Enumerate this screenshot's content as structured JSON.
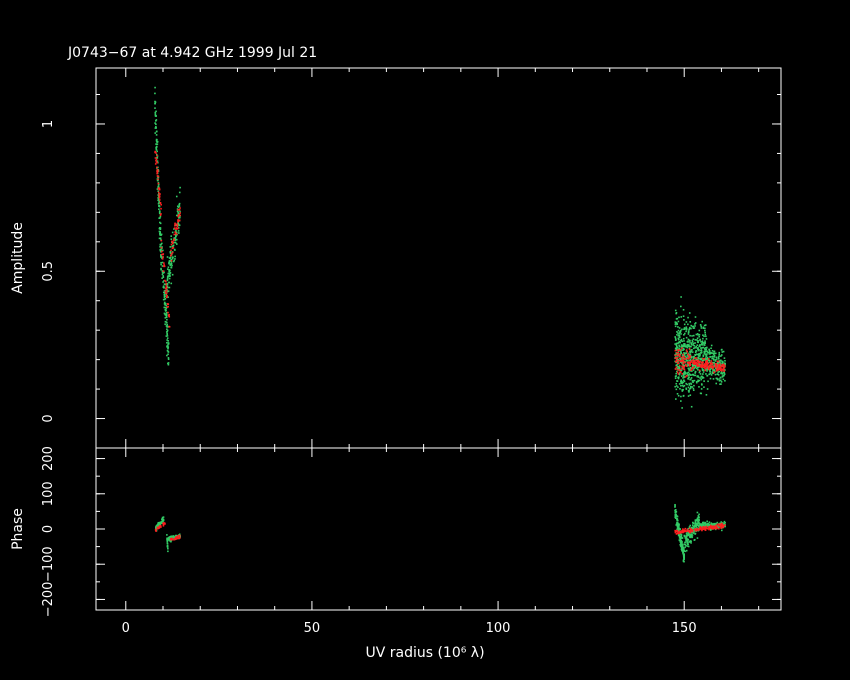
{
  "chart_data": [
    {
      "type": "scatter",
      "title": "J0743−67 at 4.942 GHz 1999 Jul 21",
      "ylabel": "Amplitude",
      "xlabel": "",
      "xlim": [
        -8,
        176
      ],
      "ylim": [
        -0.1,
        1.19
      ],
      "y_ticks": [
        0,
        0.5,
        1
      ],
      "y_tick_labels": [
        "0",
        "0.5",
        "1"
      ],
      "grid": false,
      "series": [
        {
          "color": "#33cc66",
          "clusters": [
            {
              "x_range": [
                7.8,
                9.5
              ],
              "y_at_start": 1.08,
              "y_at_end": 0.55,
              "spread": 0.06,
              "count": 140
            },
            {
              "x_range": [
                9.5,
                11.5
              ],
              "y_at_start": 0.6,
              "y_at_end": 0.22,
              "spread": 0.06,
              "count": 110
            },
            {
              "x_range": [
                11,
                14.6
              ],
              "y_at_start": 0.45,
              "y_at_end": 0.72,
              "spread": 0.06,
              "count": 150
            },
            {
              "x_range": [
                147.5,
                152
              ],
              "y_at_start": 0.22,
              "y_at_end": 0.2,
              "spread": 0.12,
              "count": 380
            },
            {
              "x_range": [
                152,
                156.5
              ],
              "y_at_start": 0.22,
              "y_at_end": 0.18,
              "spread": 0.09,
              "count": 260
            },
            {
              "x_range": [
                156.5,
                161
              ],
              "y_at_start": 0.19,
              "y_at_end": 0.17,
              "spread": 0.04,
              "count": 200
            }
          ]
        },
        {
          "color": "#ff2020",
          "clusters": [
            {
              "x_range": [
                7.8,
                9.5
              ],
              "y_at_start": 0.92,
              "y_at_end": 0.7,
              "spread": 0.03,
              "count": 40
            },
            {
              "x_range": [
                9.5,
                11.8
              ],
              "y_at_start": 0.6,
              "y_at_end": 0.32,
              "spread": 0.03,
              "count": 40
            },
            {
              "x_range": [
                12,
                14.6
              ],
              "y_at_start": 0.55,
              "y_at_end": 0.7,
              "spread": 0.03,
              "count": 45
            },
            {
              "x_range": [
                147.5,
                152
              ],
              "y_at_start": 0.2,
              "y_at_end": 0.19,
              "spread": 0.035,
              "count": 90
            },
            {
              "x_range": [
                152,
                161
              ],
              "y_at_start": 0.19,
              "y_at_end": 0.17,
              "spread": 0.015,
              "count": 160
            }
          ]
        }
      ]
    },
    {
      "type": "scatter",
      "title": "",
      "ylabel": "Phase",
      "xlabel": "UV radius  (10⁶ λ)",
      "xlim": [
        -8,
        176
      ],
      "ylim": [
        -230,
        230
      ],
      "x_ticks": [
        0,
        50,
        100,
        150
      ],
      "x_tick_labels": [
        "0",
        "50",
        "100",
        "150"
      ],
      "y_ticks": [
        -200,
        -100,
        0,
        100,
        200
      ],
      "y_tick_labels": [
        "−200",
        "−100",
        "0",
        "100",
        "200"
      ],
      "grid": false,
      "series": [
        {
          "color": "#33cc66",
          "clusters": [
            {
              "x_range": [
                8,
                10.2
              ],
              "y_at_start": 0,
              "y_at_end": 28,
              "spread": 6,
              "count": 70
            },
            {
              "x_range": [
                11,
                14.6
              ],
              "y_at_start": -30,
              "y_at_end": -20,
              "spread": 7,
              "count": 80
            },
            {
              "x_range": [
                11,
                11.3
              ],
              "y_at_start": -15,
              "y_at_end": -60,
              "spread": 4,
              "count": 15
            },
            {
              "x_range": [
                147.5,
                150
              ],
              "y_at_start": 55,
              "y_at_end": -80,
              "spread": 18,
              "count": 170
            },
            {
              "x_range": [
                150,
                154
              ],
              "y_at_start": -40,
              "y_at_end": 20,
              "spread": 25,
              "count": 170
            },
            {
              "x_range": [
                154,
                161
              ],
              "y_at_start": 10,
              "y_at_end": 10,
              "spread": 8,
              "count": 180
            }
          ]
        },
        {
          "color": "#ff2020",
          "clusters": [
            {
              "x_range": [
                8,
                10.5
              ],
              "y_at_start": -5,
              "y_at_end": 20,
              "spread": 5,
              "count": 25
            },
            {
              "x_range": [
                12,
                14.6
              ],
              "y_at_start": -30,
              "y_at_end": -22,
              "spread": 4,
              "count": 30
            },
            {
              "x_range": [
                147.5,
                161
              ],
              "y_at_start": -10,
              "y_at_end": 10,
              "spread": 5,
              "count": 160
            }
          ]
        }
      ]
    }
  ]
}
